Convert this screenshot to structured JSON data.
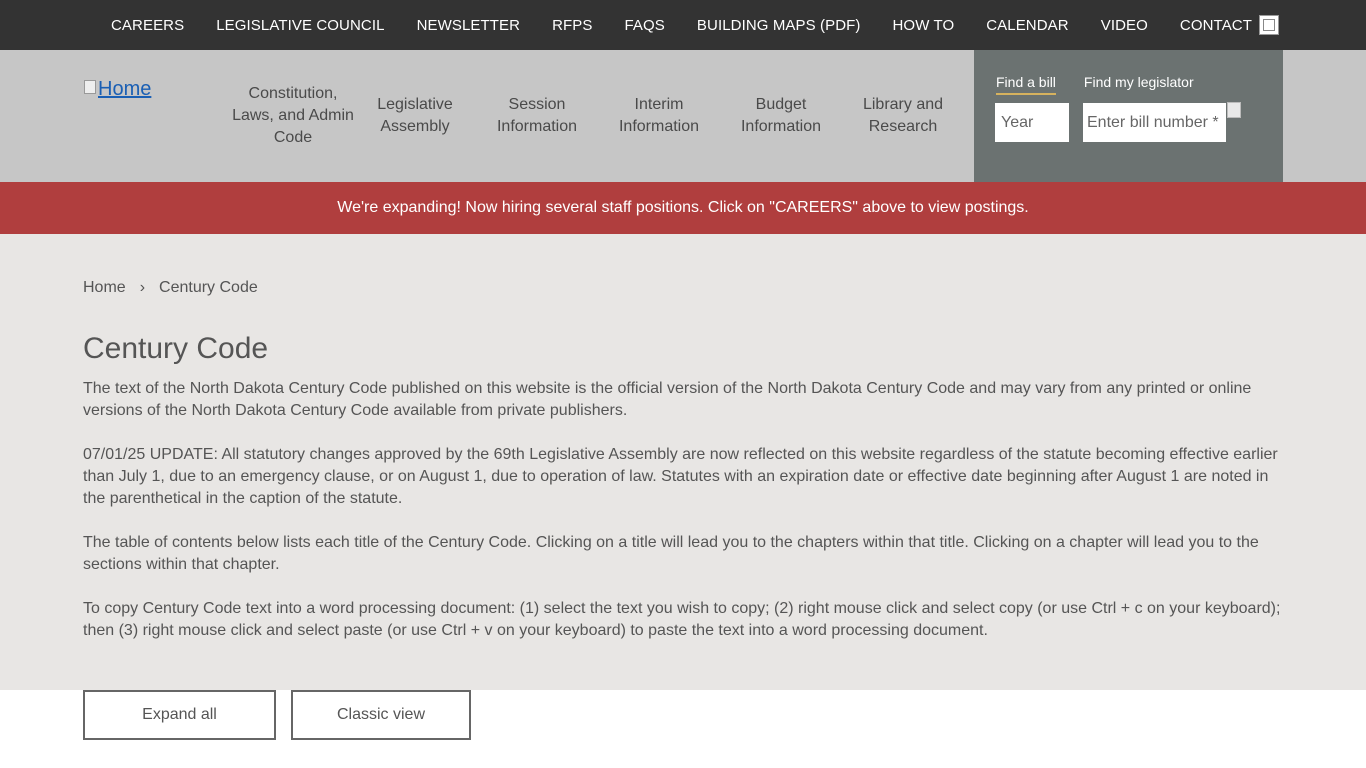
{
  "topnav": {
    "items": [
      "CAREERS",
      "LEGISLATIVE COUNCIL",
      "NEWSLETTER",
      "RFPS",
      "FAQS",
      "BUILDING MAPS (PDF)",
      "HOW TO",
      "CALENDAR",
      "VIDEO",
      "CONTACT"
    ]
  },
  "header": {
    "logo_alt": "Home",
    "nav": [
      "Constitution, Laws, and Admin Code",
      "Legislative Assembly",
      "Session Information",
      "Interim Information",
      "Budget Information",
      "Library and Research"
    ]
  },
  "search": {
    "tab_bill": "Find a bill",
    "tab_legislator": "Find my legislator",
    "year_placeholder": "Year",
    "bill_placeholder": "Enter bill number *"
  },
  "alert": {
    "text": "We're expanding! Now hiring several staff positions. Click on \"CAREERS\" above to view postings."
  },
  "breadcrumb": {
    "home": "Home",
    "separator": "›",
    "current": "Century Code"
  },
  "main": {
    "title": "Century Code",
    "paragraphs": [
      "The text of the North Dakota Century Code published on this website is the official version of the North Dakota Century Code and may vary from any printed or online versions of the North Dakota Century Code available from private publishers.",
      "07/01/25 UPDATE: All statutory changes approved by the 69th Legislative Assembly are now reflected on this website regardless of the statute becoming effective earlier than July 1, due to an emergency clause, or on August 1, due to operation of law. Statutes with an expiration date or effective date beginning after August 1 are noted in the parenthetical in the caption of the statute.",
      "The table of contents below lists each title of the Century Code. Clicking on a title will lead you to the chapters within that title. Clicking on a chapter will lead you to the sections within that chapter.",
      "To copy Century Code text into a word processing document: (1) select the text you wish to copy; (2) right mouse click and select copy (or use Ctrl + c on your keyboard); then (3) right mouse click and select paste (or use Ctrl + v on your keyboard) to paste the text into a word processing document."
    ]
  },
  "buttons": {
    "expand_all": "Expand all",
    "classic_view": "Classic view"
  },
  "colors": {
    "topbar": "#333333",
    "header": "#c6c6c6",
    "search_panel": "#6b7271",
    "alert": "#b03e3e",
    "content": "#e8e6e4",
    "tab_underline": "#d6b25e"
  }
}
